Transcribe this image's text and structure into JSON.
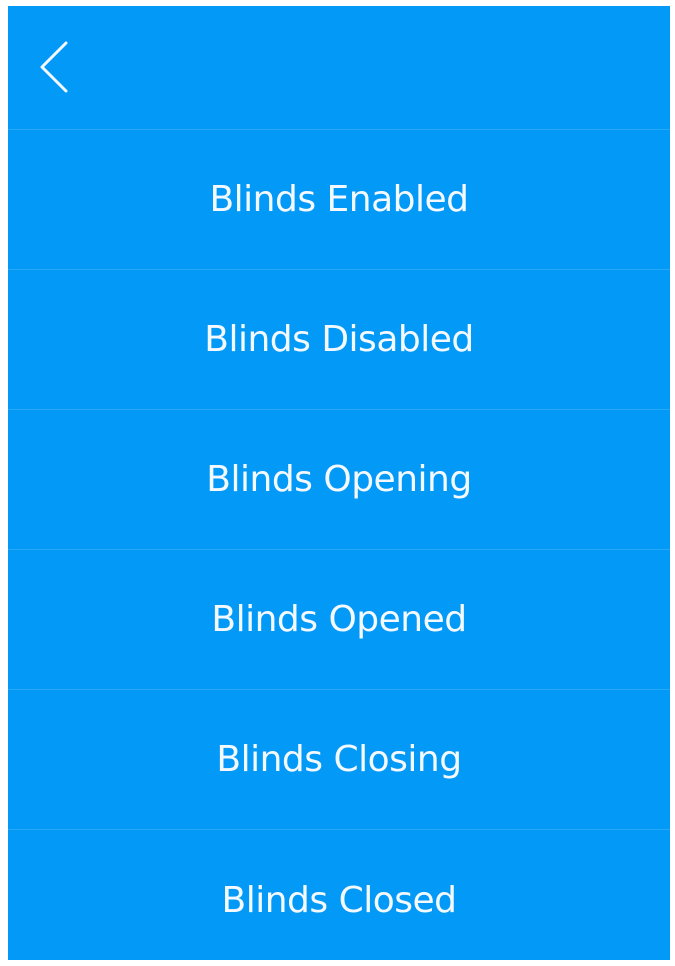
{
  "header": {
    "back_icon": "chevron-left-icon"
  },
  "menu": {
    "items": [
      {
        "label": "Blinds Enabled"
      },
      {
        "label": "Blinds Disabled"
      },
      {
        "label": "Blinds Opening"
      },
      {
        "label": "Blinds Opened"
      },
      {
        "label": "Blinds Closing"
      },
      {
        "label": "Blinds Closed"
      }
    ]
  },
  "colors": {
    "background": "#0399f7",
    "text": "#f4f9ff"
  }
}
